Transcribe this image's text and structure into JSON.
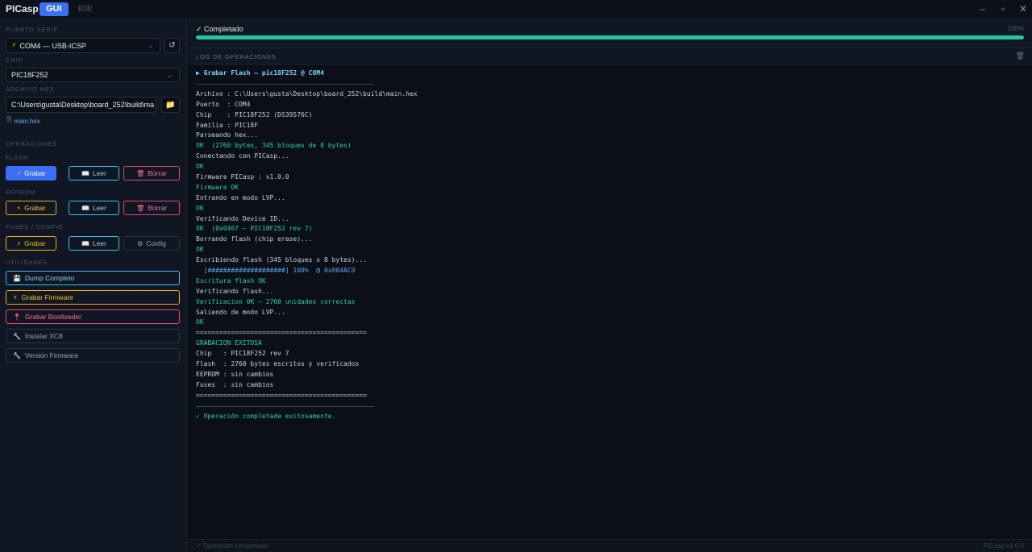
{
  "titlebar": {
    "app_title": "PICasp",
    "tab_gui": "GUI",
    "tab_ide": "IDE",
    "minimize": "–",
    "maximize": "▫",
    "close": "✕"
  },
  "sidebar": {
    "serial_label": "PUERTO SERIE",
    "serial_value": "COM4 — USB-ICSP",
    "refresh_glyph": "↺",
    "chip_label": "CHIP",
    "chip_value": "PIC18F252",
    "hex_label": "ARCHIVO HEX",
    "hex_path": "C:\\Users\\gusta\\Desktop\\board_252\\build\\main.hex",
    "hex_filename": "main.hex",
    "operations_label": "OPERACIONES",
    "flash_label": "FLASH",
    "eeprom_label": "EEPROM",
    "fuses_label": "FUSES / CONFIG",
    "btn_grabar": "Grabar",
    "btn_leer": "Leer",
    "btn_borrar": "Borrar",
    "btn_config": "Config",
    "utilities_label": "UTILIDADES",
    "util_dump": "Dump Completo",
    "util_firmware": "Grabar Firmware",
    "util_bootloader": "Grabar Bootloader",
    "util_xc8": "Instalar XC8",
    "util_version": "Versión Firmware"
  },
  "progress": {
    "status": "✓ Completado",
    "percent_text": "100%",
    "fraction": 1.0
  },
  "log": {
    "title": "LOG DE OPERACIONES",
    "header": "▶ Grabar Flash — pic18F252 @ COM4",
    "lines": [
      {
        "text": "Archivo : C:\\Users\\gusta\\Desktop\\board_252\\build\\main.hex",
        "tone": "white"
      },
      {
        "text": "Puerto  : COM4",
        "tone": "white"
      },
      {
        "text": "Chip    : PIC18F252 (DS39576C)",
        "tone": "white"
      },
      {
        "text": "Familia : PIC18F",
        "tone": "white"
      },
      {
        "text": "Parseando hex...",
        "tone": "white"
      },
      {
        "text": "OK  (2760 bytes, 345 bloques de 8 bytes)",
        "tone": "green"
      },
      {
        "text": "Conectando con PICasp...",
        "tone": "white"
      },
      {
        "text": "OK",
        "tone": "green"
      },
      {
        "text": "Firmware PICasp : v1.0.0",
        "tone": "white"
      },
      {
        "text": "Firmware OK",
        "tone": "green"
      },
      {
        "text": "Entrando en modo LVP...",
        "tone": "white"
      },
      {
        "text": "OK",
        "tone": "green"
      },
      {
        "text": "Verificando Device ID...",
        "tone": "white"
      },
      {
        "text": "OK  (0x0407 — PIC18F252 rev 7)",
        "tone": "green"
      },
      {
        "text": "Borrando flash (chip erase)...",
        "tone": "white"
      },
      {
        "text": "OK",
        "tone": "green"
      },
      {
        "text": "Escribiendo flash (345 bloques x 8 bytes)...",
        "tone": "white"
      },
      {
        "text": "  [####################] 100%  @ 0x004AC0",
        "tone": "blue"
      },
      {
        "text": "Escritura flash OK",
        "tone": "green"
      },
      {
        "text": "Verificando flash...",
        "tone": "white"
      },
      {
        "text": "Verificacion OK — 2760 unidades correctas",
        "tone": "green"
      },
      {
        "text": "Saliendo de modo LVP...",
        "tone": "white"
      },
      {
        "text": "OK",
        "tone": "green"
      },
      {
        "text": "============================================",
        "tone": "white"
      },
      {
        "text": "GRABACION EXITOSA",
        "tone": "green"
      },
      {
        "text": "Chip   : PIC18F252 rev 7",
        "tone": "white"
      },
      {
        "text": "Flash  : 2760 bytes escritos y verificados",
        "tone": "white"
      },
      {
        "text": "EEPROM : sin cambios",
        "tone": "white"
      },
      {
        "text": "Fuses  : sin cambios",
        "tone": "white"
      },
      {
        "text": "============================================",
        "tone": "white"
      }
    ],
    "footer": "✓ Operación completada exitosamente."
  },
  "statusbar": {
    "left": "✓ Operación completada",
    "right": "PICasp v1.0.0"
  },
  "colors": {
    "accent": "#3b6ff5",
    "success": "#2bd4a0",
    "warning": "#f5a524",
    "danger": "#e5486a",
    "info": "#38bdf8"
  },
  "icons": {
    "serial": "zap-icon",
    "refresh": "refresh-icon",
    "folder": "folder-icon",
    "file": "file-icon",
    "grabar": "zap-icon",
    "leer": "book-icon",
    "borrar": "trash-icon",
    "config": "gear-icon",
    "dump": "floppy-icon",
    "bootloader": "pin-icon",
    "xc8": "wrench-icon",
    "version": "wrench-icon",
    "clear_log": "trash-icon"
  }
}
